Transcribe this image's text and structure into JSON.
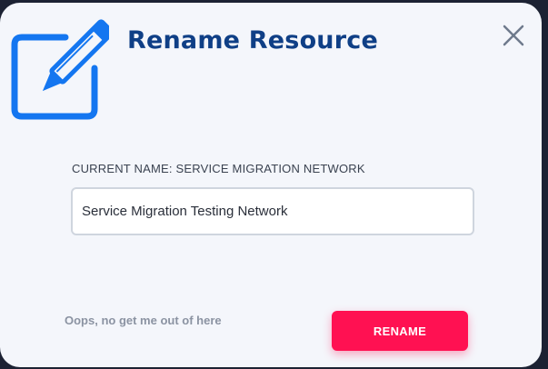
{
  "dialog": {
    "title": "Rename Resource",
    "header_icon": "edit-pencil-icon",
    "close_icon": "close-icon",
    "current_name_label": "CURRENT NAME: SERVICE MIGRATION NETWORK",
    "name_input": {
      "value": "Service Migration Testing Network",
      "placeholder": ""
    },
    "cancel_label": "Oops, no get me out of here",
    "rename_label": "RENAME"
  },
  "colors": {
    "title": "#0f3f86",
    "icon": "#1476f0",
    "primary_button": "#ff1152",
    "dialog_background": "#f4f6fb"
  }
}
